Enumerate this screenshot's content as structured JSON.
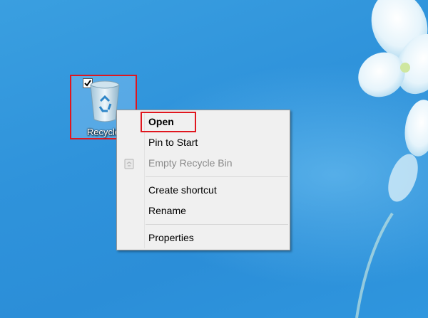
{
  "desktop": {
    "background_color": "#2f93db",
    "icon": {
      "label": "Recycle",
      "icon_name": "recycle-bin-icon",
      "checkbox_checked": true
    }
  },
  "context_menu": {
    "items": [
      {
        "label": "Open",
        "bold": true,
        "enabled": true
      },
      {
        "label": "Pin to Start",
        "enabled": true
      },
      {
        "label": "Empty Recycle Bin",
        "enabled": false,
        "icon_name": "recycle-bin-small-icon"
      },
      {
        "label": "Create shortcut",
        "enabled": true
      },
      {
        "label": "Rename",
        "enabled": true
      },
      {
        "label": "Properties",
        "enabled": true
      }
    ]
  },
  "annotation": {
    "highlight_color": "#e0161e"
  }
}
